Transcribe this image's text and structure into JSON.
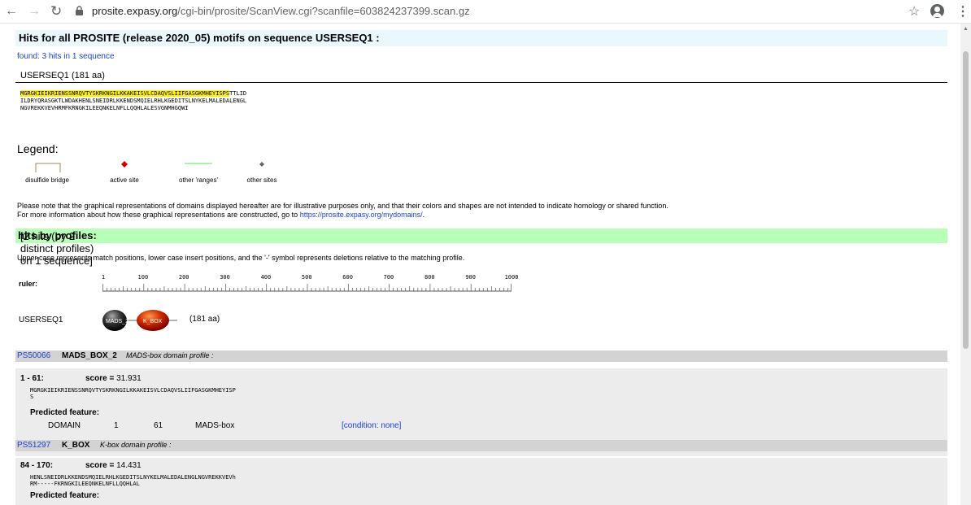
{
  "browser": {
    "url_main": "prosite.expasy.org",
    "url_path": "/cgi-bin/prosite/ScanView.cgi?scanfile=603824237399.scan.gz"
  },
  "page": {
    "header": "Hits for all PROSITE (release 2020_05) motifs on sequence USERSEQ1 :",
    "found": "found: 3 hits in 1 sequence",
    "seq_label": "USERSEQ1 (181 aa)",
    "sequence": {
      "line1_hl": "MGRGKIEIKRIENSSNRQVTYSKRKNGILKKAKEISVLCDAQVSLIIFGASGKMHEYISPS",
      "line1_rest": "TTLID",
      "line2": "ILDRYQRASGKTLWDAKHENLSNEIDRLKKENDSMQIELRHLKGEDITSLNYKELMALEDALENGL",
      "line3": "NGVREKKVEVHRMFKRNGKILEEQNKELNFLLQQHLALESVGNMHGQWI"
    },
    "legend": {
      "title": "Legend:",
      "items": [
        "disulfide bridge",
        "active site",
        "other 'ranges'",
        "other sites"
      ]
    },
    "note_line1": "Please note that the graphical representations of domains displayed hereafter are for illustrative purposes only, and that their colors and shapes are not intended to indicate homology or shared function.",
    "note_line2_prefix": "For more information about how these graphical representations are constructed, go to ",
    "note_link": "https://prosite.expasy.org/mydomains/",
    "note_line2_suffix": ".",
    "profiles_title": "hits by profiles:",
    "profiles_rest": " [2 hits (by 2 distinct profiles) on 1 sequence]",
    "upper_note": "Upper case represents match positions, lower case insert positions, and the '-' symbol represents deletions relative to the matching profile.",
    "ruler_label": "ruler:",
    "ruler_ticks": [
      "1",
      "100",
      "200",
      "300",
      "400",
      "500",
      "600",
      "700",
      "800",
      "900",
      "1000"
    ],
    "seq_name": "USERSEQ1",
    "domains": [
      "MADS_2",
      "K_BOX"
    ],
    "seq_aa": "(181 aa)"
  },
  "hits": [
    {
      "id": "PS50066",
      "name": "MADS_BOX_2",
      "desc": "MADS-box domain profile :",
      "range": "1 - 61:",
      "score_label": "score = ",
      "score": "31.931",
      "seq_line1": "MGRGKIEIKRIENSSNRQVTYSKRKNGILKKAKEISVLCDAQVSLIIFGASGKMHEYISP",
      "seq_line2": "S",
      "pf_label": "Predicted feature:",
      "feature": {
        "type": "DOMAIN",
        "start": "1",
        "end": "61",
        "name": "MADS-box",
        "condition": "[condition: none]"
      }
    },
    {
      "id": "PS51297",
      "name": "K_BOX",
      "desc": "K-box domain profile :",
      "range": "84 - 170:",
      "score_label": "score = ",
      "score": "14.431",
      "seq_line1": "HENLSNEIDRLKKENDSMQIELRHLKGEDITSLNYKELMALEDALENGLNGVREKKVEVh",
      "seq_line2": "RM-----FKRNGKILEEQNKELNFLLQQHLAL",
      "pf_label": "Predicted feature:"
    }
  ]
}
